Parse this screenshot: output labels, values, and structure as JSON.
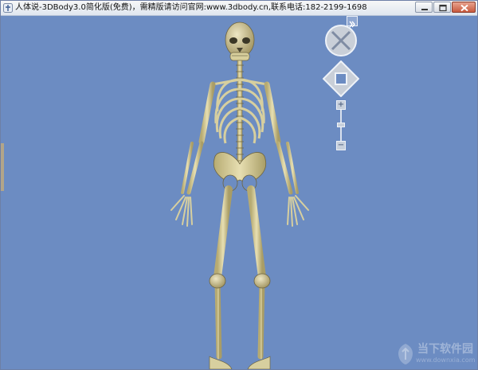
{
  "window": {
    "title": "人体说-3DBody3.0简化版(免费)，需精版请访问官网:www.3dbody.cn,联系电话:182-2199-1698"
  },
  "icons": {
    "app": "app-icon",
    "minimize": "minimize-icon",
    "maximize": "maximize-icon",
    "close": "close-icon",
    "expand": "double-chevron-right-icon",
    "rotate": "rotate-orb-icon",
    "pan": "pan-diamond-icon",
    "zoom_in": "plus-icon",
    "zoom_out": "minus-icon"
  },
  "controls": {
    "expand_label": "»",
    "zoom_in_label": "+",
    "zoom_out_label": "−"
  },
  "watermark": {
    "text": "当下软件园",
    "url": "www.downxia.com"
  },
  "colors": {
    "background": "#6c8cc2",
    "bone": "#d7cf9f"
  }
}
